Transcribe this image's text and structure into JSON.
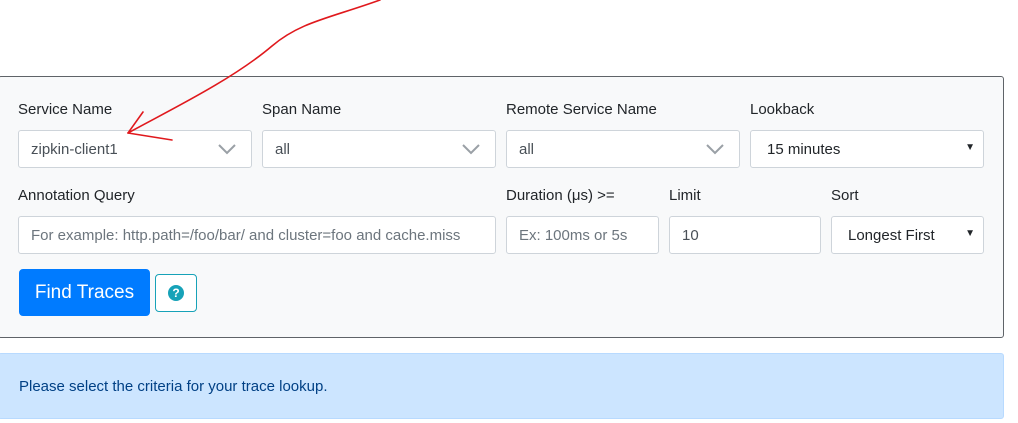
{
  "search_form": {
    "service_name": {
      "label": "Service Name",
      "value": "zipkin-client1"
    },
    "span_name": {
      "label": "Span Name",
      "value": "all"
    },
    "remote_service_name": {
      "label": "Remote Service Name",
      "value": "all"
    },
    "lookback": {
      "label": "Lookback",
      "value": "15 minutes"
    },
    "annotation_query": {
      "label": "Annotation Query",
      "placeholder": "For example: http.path=/foo/bar/ and cluster=foo and cache.miss"
    },
    "duration": {
      "label": "Duration (μs) >=",
      "placeholder": "Ex: 100ms or 5s"
    },
    "limit": {
      "label": "Limit",
      "value": "10"
    },
    "sort": {
      "label": "Sort",
      "value": "Longest First"
    },
    "find_button_label": "Find Traces",
    "help_icon": "question-circle-icon"
  },
  "info_message": "Please select the criteria for your trace lookup.",
  "colors": {
    "primary": "#007bff",
    "info": "#17a2b8",
    "alert_bg": "#cce5ff",
    "annotation": "#e0191d"
  }
}
